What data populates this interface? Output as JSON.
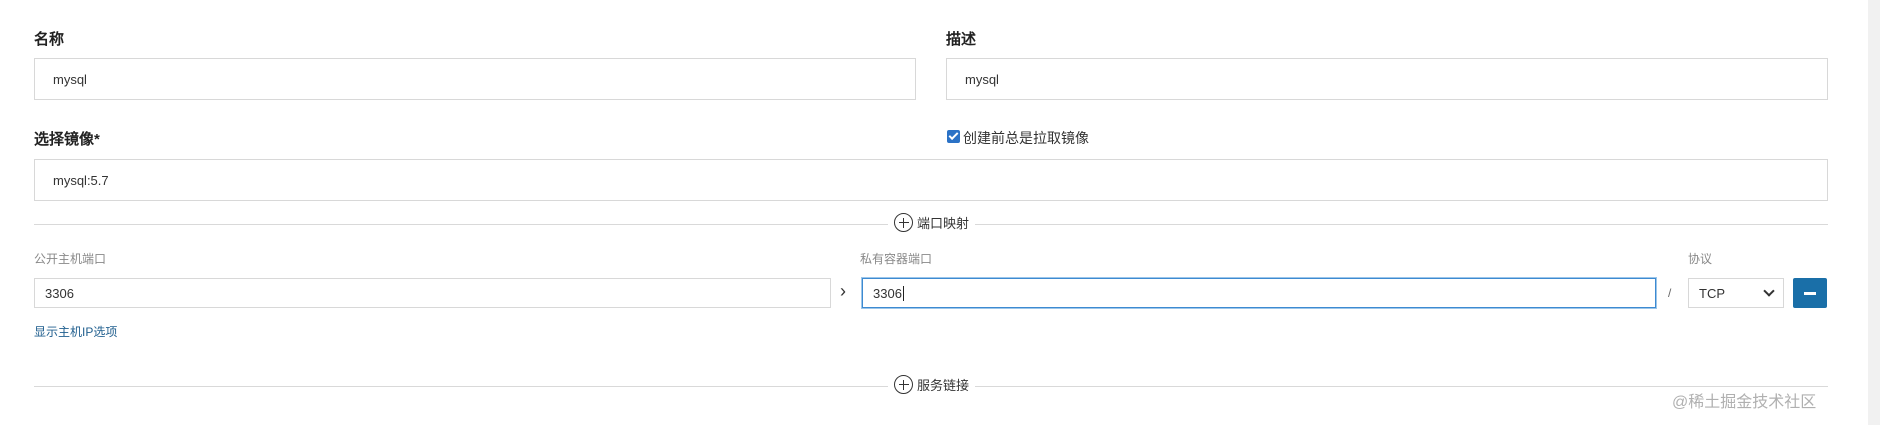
{
  "form": {
    "name_label": "名称",
    "name_value": "mysql",
    "description_label": "描述",
    "description_value": "mysql",
    "image_label": "选择镜像*",
    "image_value": "mysql:5.7",
    "always_pull_label": "创建前总是拉取镜像",
    "always_pull_checked": true
  },
  "port_mapping": {
    "section_title": "端口映射",
    "public_port_label": "公开主机端口",
    "private_port_label": "私有容器端口",
    "protocol_label": "协议",
    "public_port_value": "3306",
    "private_port_value": "3306",
    "protocol_value": "TCP",
    "separator": "/",
    "show_host_ip_link": "显示主机IP选项"
  },
  "service_links": {
    "section_title": "服务链接"
  },
  "watermark": "@稀土掘金技术社区",
  "colors": {
    "accent": "#1a6fa8",
    "checkbox": "#2b72c6",
    "focus_border": "#3d8ad1"
  }
}
